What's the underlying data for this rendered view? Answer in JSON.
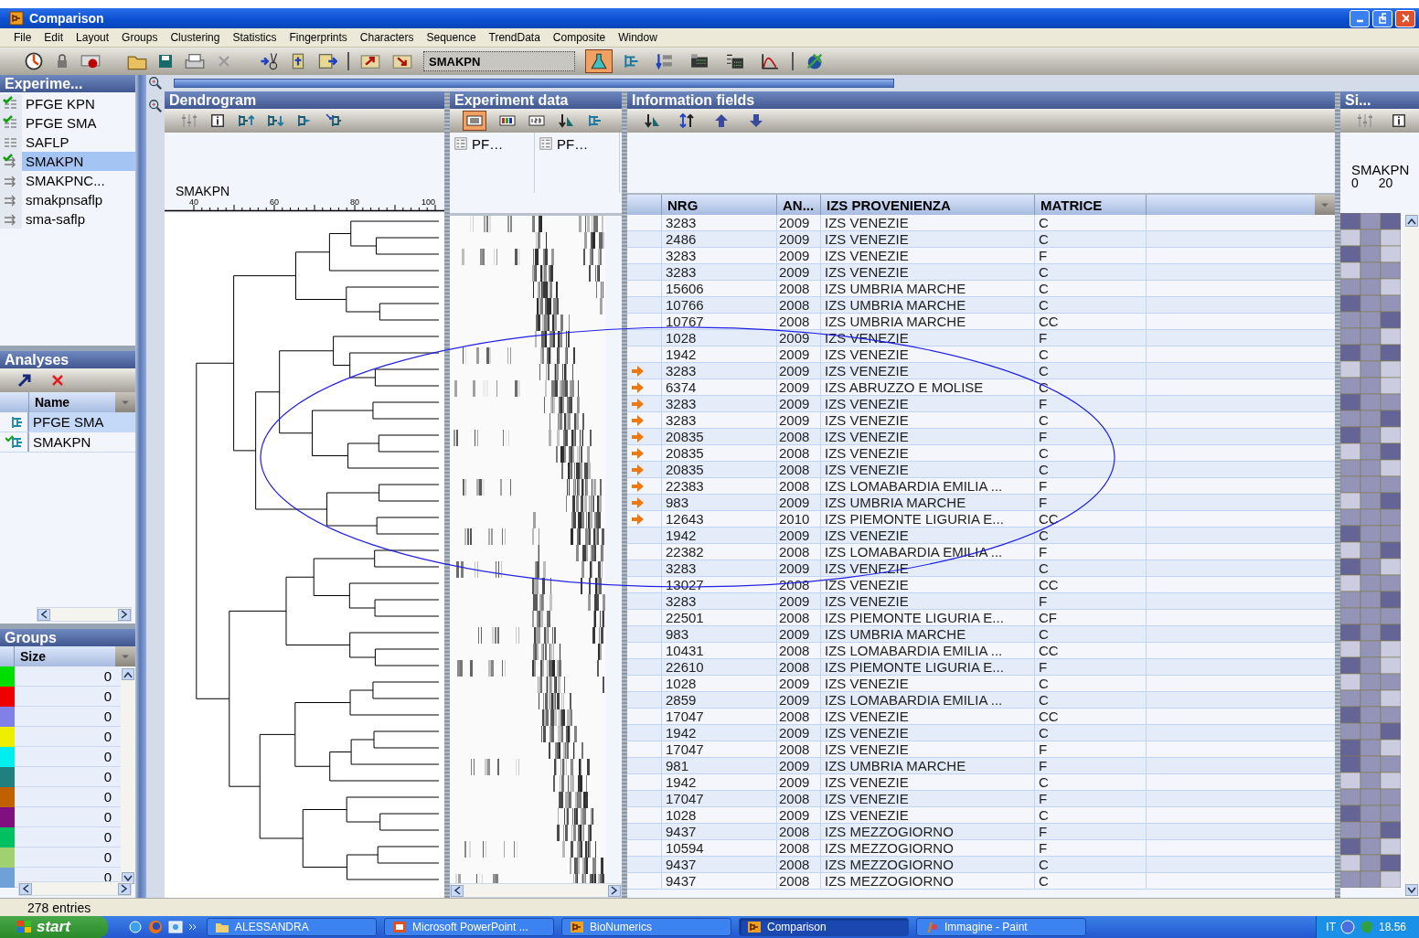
{
  "window": {
    "title": "Comparison"
  },
  "menu": [
    "File",
    "Edit",
    "Layout",
    "Groups",
    "Clustering",
    "Statistics",
    "Fingerprints",
    "Characters",
    "Sequence",
    "TrendData",
    "Composite",
    "Window"
  ],
  "toolbar": {
    "database_field": "SMAKPN"
  },
  "experiments": {
    "title": "Experime...",
    "items": [
      {
        "label": "PFGE KPN",
        "kind": "fingerprint",
        "loaded": true,
        "selected": false
      },
      {
        "label": "PFGE SMA",
        "kind": "fingerprint",
        "loaded": true,
        "selected": false
      },
      {
        "label": "SAFLP",
        "kind": "fingerprint",
        "loaded": false,
        "selected": false
      },
      {
        "label": "SMAKPN",
        "kind": "composite",
        "loaded": true,
        "selected": true
      },
      {
        "label": "SMAKPNC...",
        "kind": "composite",
        "loaded": false,
        "selected": false
      },
      {
        "label": "smakpnsaflp",
        "kind": "composite",
        "loaded": false,
        "selected": false
      },
      {
        "label": "sma-saflp",
        "kind": "composite",
        "loaded": false,
        "selected": false
      }
    ]
  },
  "analyses": {
    "title": "Analyses",
    "column": "Name",
    "items": [
      {
        "label": "PFGE SMA",
        "loaded": false,
        "selected": true
      },
      {
        "label": "SMAKPN",
        "loaded": true,
        "selected": false
      }
    ]
  },
  "groups": {
    "title": "Groups",
    "column": "Size",
    "items": [
      {
        "color": "#00dd00",
        "size": "0"
      },
      {
        "color": "#ee0000",
        "size": "0"
      },
      {
        "color": "#8080e8",
        "size": "0"
      },
      {
        "color": "#eeee00",
        "size": "0"
      },
      {
        "color": "#00eeee",
        "size": "0"
      },
      {
        "color": "#208080",
        "size": "0"
      },
      {
        "color": "#c06000",
        "size": "0"
      },
      {
        "color": "#801080",
        "size": "0"
      },
      {
        "color": "#00c060",
        "size": "0"
      },
      {
        "color": "#a0d070",
        "size": "0"
      },
      {
        "color": "#70a0d8",
        "size": "0"
      }
    ]
  },
  "dendrogram": {
    "title": "Dendrogram",
    "experiment": "SMAKPN",
    "scale": [
      "40",
      "60",
      "80",
      "100"
    ]
  },
  "experiment_data": {
    "title": "Experiment data",
    "columns": [
      "PF…",
      "PF…"
    ]
  },
  "information_fields": {
    "title": "Information fields",
    "columns": [
      "NRG",
      "AN...",
      "IZS PROVENIENZA",
      "MATRICE"
    ],
    "rows": [
      {
        "nrg": "3283",
        "an": "2009",
        "provenienza": "IZS VENEZIE",
        "matrice": "C",
        "marked": false
      },
      {
        "nrg": "2486",
        "an": "2009",
        "provenienza": "IZS VENEZIE",
        "matrice": "C",
        "marked": false
      },
      {
        "nrg": "3283",
        "an": "2009",
        "provenienza": "IZS VENEZIE",
        "matrice": "F",
        "marked": false
      },
      {
        "nrg": "3283",
        "an": "2009",
        "provenienza": "IZS VENEZIE",
        "matrice": "C",
        "marked": false
      },
      {
        "nrg": "15606",
        "an": "2008",
        "provenienza": "IZS UMBRIA MARCHE",
        "matrice": "C",
        "marked": false
      },
      {
        "nrg": "10766",
        "an": "2008",
        "provenienza": "IZS UMBRIA MARCHE",
        "matrice": "C",
        "marked": false
      },
      {
        "nrg": "10767",
        "an": "2008",
        "provenienza": "IZS UMBRIA MARCHE",
        "matrice": "CC",
        "marked": false
      },
      {
        "nrg": "1028",
        "an": "2009",
        "provenienza": "IZS VENEZIE",
        "matrice": "F",
        "marked": false
      },
      {
        "nrg": "1942",
        "an": "2009",
        "provenienza": "IZS VENEZIE",
        "matrice": "C",
        "marked": false
      },
      {
        "nrg": "3283",
        "an": "2009",
        "provenienza": "IZS VENEZIE",
        "matrice": "C",
        "marked": true
      },
      {
        "nrg": "6374",
        "an": "2009",
        "provenienza": "IZS ABRUZZO E MOLISE",
        "matrice": "C",
        "marked": true
      },
      {
        "nrg": "3283",
        "an": "2009",
        "provenienza": "IZS VENEZIE",
        "matrice": "F",
        "marked": true
      },
      {
        "nrg": "3283",
        "an": "2009",
        "provenienza": "IZS VENEZIE",
        "matrice": "C",
        "marked": true
      },
      {
        "nrg": "20835",
        "an": "2008",
        "provenienza": "IZS VENEZIE",
        "matrice": "F",
        "marked": true
      },
      {
        "nrg": "20835",
        "an": "2008",
        "provenienza": "IZS VENEZIE",
        "matrice": "C",
        "marked": true
      },
      {
        "nrg": "20835",
        "an": "2008",
        "provenienza": "IZS VENEZIE",
        "matrice": "C",
        "marked": true
      },
      {
        "nrg": "22383",
        "an": "2008",
        "provenienza": "IZS LOMABARDIA EMILIA ...",
        "matrice": "F",
        "marked": true
      },
      {
        "nrg": "983",
        "an": "2009",
        "provenienza": "IZS UMBRIA MARCHE",
        "matrice": "F",
        "marked": true
      },
      {
        "nrg": "12643",
        "an": "2010",
        "provenienza": "IZS PIEMONTE LIGURIA E...",
        "matrice": "CC",
        "marked": true
      },
      {
        "nrg": "1942",
        "an": "2009",
        "provenienza": "IZS VENEZIE",
        "matrice": "C",
        "marked": false
      },
      {
        "nrg": "22382",
        "an": "2008",
        "provenienza": "IZS LOMABARDIA EMILIA ...",
        "matrice": "F",
        "marked": false
      },
      {
        "nrg": "3283",
        "an": "2009",
        "provenienza": "IZS VENEZIE",
        "matrice": "C",
        "marked": false
      },
      {
        "nrg": "13027",
        "an": "2008",
        "provenienza": "IZS VENEZIE",
        "matrice": "CC",
        "marked": false
      },
      {
        "nrg": "3283",
        "an": "2009",
        "provenienza": "IZS VENEZIE",
        "matrice": "F",
        "marked": false
      },
      {
        "nrg": "22501",
        "an": "2008",
        "provenienza": "IZS PIEMONTE LIGURIA E...",
        "matrice": "CF",
        "marked": false
      },
      {
        "nrg": "983",
        "an": "2009",
        "provenienza": "IZS UMBRIA MARCHE",
        "matrice": "C",
        "marked": false
      },
      {
        "nrg": "10431",
        "an": "2008",
        "provenienza": "IZS LOMABARDIA EMILIA ...",
        "matrice": "CC",
        "marked": false
      },
      {
        "nrg": "22610",
        "an": "2008",
        "provenienza": "IZS PIEMONTE LIGURIA E...",
        "matrice": "F",
        "marked": false
      },
      {
        "nrg": "1028",
        "an": "2009",
        "provenienza": "IZS VENEZIE",
        "matrice": "C",
        "marked": false
      },
      {
        "nrg": "2859",
        "an": "2009",
        "provenienza": "IZS LOMABARDIA EMILIA ...",
        "matrice": "C",
        "marked": false
      },
      {
        "nrg": "17047",
        "an": "2008",
        "provenienza": "IZS VENEZIE",
        "matrice": "CC",
        "marked": false
      },
      {
        "nrg": "1942",
        "an": "2009",
        "provenienza": "IZS VENEZIE",
        "matrice": "C",
        "marked": false
      },
      {
        "nrg": "17047",
        "an": "2008",
        "provenienza": "IZS VENEZIE",
        "matrice": "F",
        "marked": false
      },
      {
        "nrg": "981",
        "an": "2009",
        "provenienza": "IZS UMBRIA MARCHE",
        "matrice": "F",
        "marked": false
      },
      {
        "nrg": "1942",
        "an": "2009",
        "provenienza": "IZS VENEZIE",
        "matrice": "C",
        "marked": false
      },
      {
        "nrg": "17047",
        "an": "2008",
        "provenienza": "IZS VENEZIE",
        "matrice": "F",
        "marked": false
      },
      {
        "nrg": "1028",
        "an": "2009",
        "provenienza": "IZS VENEZIE",
        "matrice": "C",
        "marked": false
      },
      {
        "nrg": "9437",
        "an": "2008",
        "provenienza": "IZS MEZZOGIORNO",
        "matrice": "F",
        "marked": false
      },
      {
        "nrg": "10594",
        "an": "2008",
        "provenienza": "IZS MEZZOGIORNO",
        "matrice": "F",
        "marked": false
      },
      {
        "nrg": "9437",
        "an": "2008",
        "provenienza": "IZS MEZZOGIORNO",
        "matrice": "C",
        "marked": false
      },
      {
        "nrg": "9437",
        "an": "2008",
        "provenienza": "IZS MEZZOGIORNO",
        "matrice": "C",
        "marked": false
      }
    ]
  },
  "similarity": {
    "title": "Si...",
    "experiment": "SMAKPN",
    "scale": [
      "0",
      "20"
    ]
  },
  "status_bar": "278 entries",
  "taskbar": {
    "start": "start",
    "tasks": [
      {
        "label": "ALESSANDRA",
        "kind": "folder",
        "selected": false
      },
      {
        "label": "Microsoft PowerPoint ...",
        "kind": "powerpoint",
        "selected": false
      },
      {
        "label": "BioNumerics",
        "kind": "app",
        "selected": false
      },
      {
        "label": "Comparison",
        "kind": "app",
        "selected": true
      },
      {
        "label": "Immagine - Paint",
        "kind": "paint",
        "selected": false
      }
    ],
    "language": "IT",
    "clock": "18.56"
  }
}
